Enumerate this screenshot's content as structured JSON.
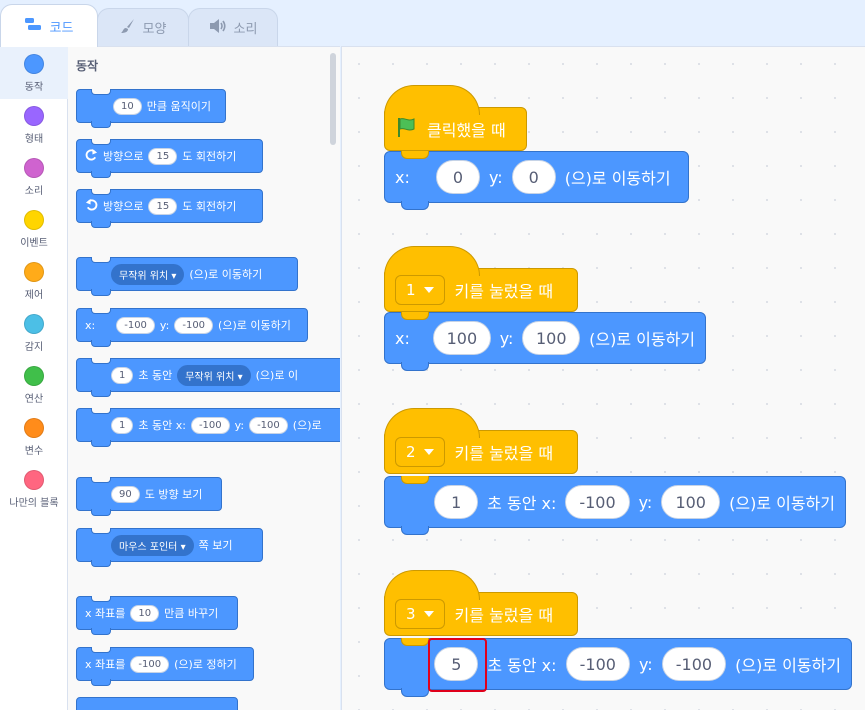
{
  "tabs": [
    {
      "label": "코드",
      "icon": "code-icon",
      "active": true
    },
    {
      "label": "모양",
      "icon": "brush-icon",
      "active": false
    },
    {
      "label": "소리",
      "icon": "speaker-icon",
      "active": false
    }
  ],
  "categories": [
    {
      "label": "동작",
      "color": "#4c97ff"
    },
    {
      "label": "형태",
      "color": "#9966ff"
    },
    {
      "label": "소리",
      "color": "#cf63cf"
    },
    {
      "label": "이벤트",
      "color": "#ffd500"
    },
    {
      "label": "제어",
      "color": "#ffab19"
    },
    {
      "label": "감지",
      "color": "#4cbfe6"
    },
    {
      "label": "연산",
      "color": "#40bf4a"
    },
    {
      "label": "변수",
      "color": "#ff8c1a"
    },
    {
      "label": "나만의 블록",
      "color": "#ff6680"
    }
  ],
  "palette": {
    "title": "동작",
    "move": {
      "value": "10",
      "text": "만큼 움직이기"
    },
    "turn_right": {
      "prefix": "방향으로",
      "value": "15",
      "suffix": "도 회전하기"
    },
    "turn_left": {
      "prefix": "방향으로",
      "value": "15",
      "suffix": "도 회전하기"
    },
    "goto": {
      "drop": "무작위 위치",
      "suffix": "(으)로 이동하기"
    },
    "goto_xy": {
      "x_label": "x:",
      "x": "-100",
      "y_label": "y:",
      "y": "-100",
      "suffix": "(으)로 이동하기"
    },
    "glide": {
      "value": "1",
      "mid": "초 동안",
      "drop": "무작위 위치",
      "suffix": "(으)로 이"
    },
    "glide_xy": {
      "value": "1",
      "mid": "초 동안 x:",
      "x": "-100",
      "y_label": "y:",
      "y": "-100",
      "suffix": "(으)로"
    },
    "point_dir": {
      "value": "90",
      "suffix": "도 방향 보기"
    },
    "point_towards": {
      "drop": "마우스 포인터",
      "suffix": "쪽 보기"
    },
    "change_x": {
      "prefix": "x 좌표를",
      "value": "10",
      "suffix": "만큼 바꾸기"
    },
    "set_x": {
      "prefix": "x 좌표를",
      "value": "-100",
      "suffix": "(으)로 정하기"
    }
  },
  "scripts": {
    "s1": {
      "hat": "클릭했을 때",
      "x_label": "x:",
      "x": "0",
      "y_label": "y:",
      "y": "0",
      "suffix": "(으)로 이동하기"
    },
    "s2": {
      "key": "1",
      "hat": "키를 눌렀을 때",
      "x_label": "x:",
      "x": "100",
      "y_label": "y:",
      "y": "100",
      "suffix": "(으)로 이동하기"
    },
    "s3": {
      "key": "2",
      "hat": "키를 눌렀을 때",
      "secs": "1",
      "mid": "초 동안 x:",
      "x": "-100",
      "y_label": "y:",
      "y": "100",
      "suffix": "(으)로 이동하기"
    },
    "s4": {
      "key": "3",
      "hat": "키를 눌렀을 때",
      "secs": "5",
      "mid": "초 동안 x:",
      "x": "-100",
      "y_label": "y:",
      "y": "-100",
      "suffix": "(으)로 이동하기"
    }
  },
  "colors": {
    "motion": "#4c97ff",
    "events": "#ffbf00",
    "highlight": "#e0001b"
  }
}
